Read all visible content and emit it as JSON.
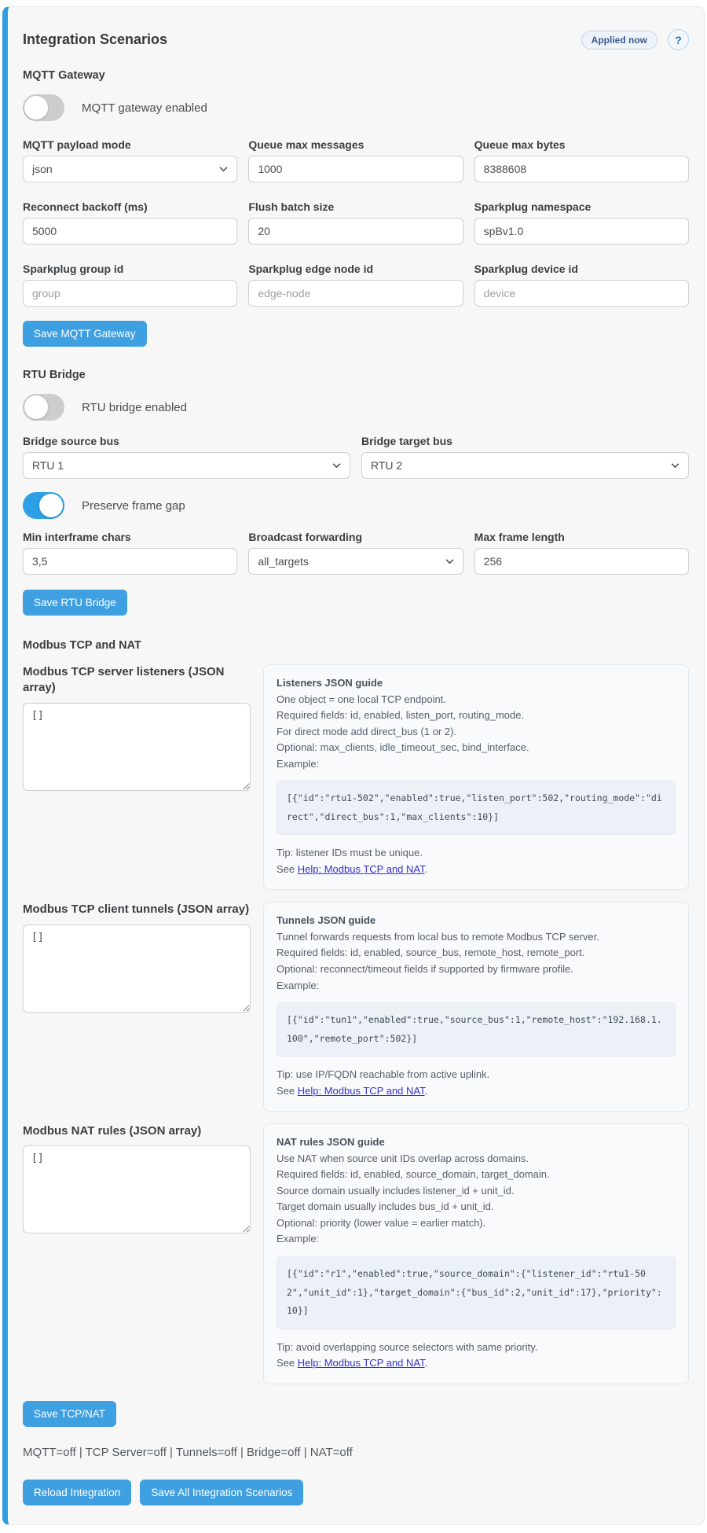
{
  "colors": {
    "accent_border": "#2d9fe0",
    "button": "#3fa0e1",
    "toggle_on": "#2d9fe4",
    "toggle_off": "#cdcdcd",
    "card_bg": "#f7f7f8",
    "panel_bg": "#f9fafc",
    "code_bg": "#ecf1f8",
    "link": "#3533d1",
    "badge_text": "#3a5a8c"
  },
  "header": {
    "title": "Integration Scenarios",
    "badge": "Applied now",
    "help_label": "?"
  },
  "mqtt": {
    "section_title": "MQTT Gateway",
    "enabled_toggle_label": "MQTT gateway enabled",
    "fields": [
      {
        "label": "MQTT payload mode",
        "value": "json",
        "type": "select"
      },
      {
        "label": "Queue max messages",
        "value": "1000"
      },
      {
        "label": "Queue max bytes",
        "value": "8388608"
      },
      {
        "label": "Reconnect backoff (ms)",
        "value": "5000"
      },
      {
        "label": "Flush batch size",
        "value": "20"
      },
      {
        "label": "Sparkplug namespace",
        "value": "spBv1.0"
      },
      {
        "label": "Sparkplug group id",
        "placeholder": "group"
      },
      {
        "label": "Sparkplug edge node id",
        "placeholder": "edge-node"
      },
      {
        "label": "Sparkplug device id",
        "placeholder": "device"
      }
    ],
    "save_label": "Save MQTT Gateway"
  },
  "rtu": {
    "section_title": "RTU Bridge",
    "enabled_toggle_label": "RTU bridge enabled",
    "source_bus": {
      "label": "Bridge source bus",
      "value": "RTU 1"
    },
    "target_bus": {
      "label": "Bridge target bus",
      "value": "RTU 2"
    },
    "preserve_frame_gap_label": "Preserve frame gap",
    "fields": [
      {
        "label": "Min interframe chars",
        "value": "3,5"
      },
      {
        "label": "Broadcast forwarding",
        "value": "all_targets",
        "type": "select"
      },
      {
        "label": "Max frame length",
        "value": "256"
      }
    ],
    "save_label": "Save RTU Bridge"
  },
  "tcpnat": {
    "section_title": "Modbus TCP and NAT",
    "blocks": [
      {
        "label": "Modbus TCP server listeners (JSON array)",
        "value": "[]",
        "guide": {
          "title": "Listeners JSON guide",
          "lines": [
            "One object = one local TCP endpoint.",
            "Required fields: id, enabled, listen_port, routing_mode.",
            "For direct mode add direct_bus (1 or 2).",
            "Optional: max_clients, idle_timeout_sec, bind_interface.",
            "Example:"
          ],
          "code": "[{\"id\":\"rtu1-502\",\"enabled\":true,\"listen_port\":502,\"routing_mode\":\"direct\",\"direct_bus\":1,\"max_clients\":10}]",
          "tip": "Tip: listener IDs must be unique.",
          "see_prefix": "See ",
          "link": "Help: Modbus TCP and NAT",
          "see_suffix": "."
        }
      },
      {
        "label": "Modbus TCP client tunnels (JSON array)",
        "value": "[]",
        "guide": {
          "title": "Tunnels JSON guide",
          "lines": [
            "Tunnel forwards requests from local bus to remote Modbus TCP server.",
            "Required fields: id, enabled, source_bus, remote_host, remote_port.",
            "Optional: reconnect/timeout fields if supported by firmware profile.",
            "Example:"
          ],
          "code": "[{\"id\":\"tun1\",\"enabled\":true,\"source_bus\":1,\"remote_host\":\"192.168.1.100\",\"remote_port\":502}]",
          "tip": "Tip: use IP/FQDN reachable from active uplink.",
          "see_prefix": "See ",
          "link": "Help: Modbus TCP and NAT",
          "see_suffix": "."
        }
      },
      {
        "label": "Modbus NAT rules (JSON array)",
        "value": "[]",
        "guide": {
          "title": "NAT rules JSON guide",
          "lines": [
            "Use NAT when source unit IDs overlap across domains.",
            "Required fields: id, enabled, source_domain, target_domain.",
            "Source domain usually includes listener_id + unit_id.",
            "Target domain usually includes bus_id + unit_id.",
            "Optional: priority (lower value = earlier match).",
            "Example:"
          ],
          "code": "[{\"id\":\"r1\",\"enabled\":true,\"source_domain\":{\"listener_id\":\"rtu1-502\",\"unit_id\":1},\"target_domain\":{\"bus_id\":2,\"unit_id\":17},\"priority\":10}]",
          "tip": "Tip: avoid overlapping source selectors with same priority.",
          "see_prefix": "See ",
          "link": "Help: Modbus TCP and NAT",
          "see_suffix": "."
        }
      }
    ],
    "save_label": "Save TCP/NAT"
  },
  "footer": {
    "status": "MQTT=off | TCP Server=off | Tunnels=off | Bridge=off | NAT=off",
    "reload_label": "Reload Integration",
    "save_all_label": "Save All Integration Scenarios"
  }
}
